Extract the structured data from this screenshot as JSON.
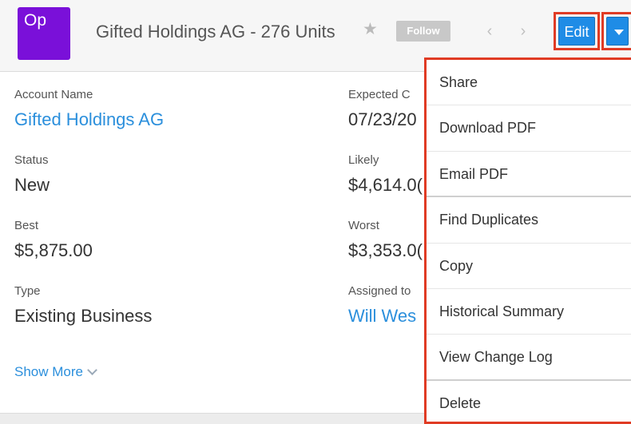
{
  "header": {
    "module_badge": "Op",
    "record_title": "Gifted Holdings AG - 276 Units",
    "follow_label": "Follow",
    "edit_label": "Edit",
    "badge_color": "#7a10d9",
    "accent_color": "#1f8ce6",
    "highlight_color": "#e03b24"
  },
  "fields_left": [
    {
      "label": "Account Name",
      "value": "Gifted Holdings AG"
    },
    {
      "label": "Status",
      "value": "New"
    },
    {
      "label": "Best",
      "value": "$5,875.00"
    },
    {
      "label": "Type",
      "value": "Existing Business"
    }
  ],
  "fields_right": [
    {
      "label": "Expected C",
      "value": "07/23/20"
    },
    {
      "label": "Likely",
      "value": "$4,614.0("
    },
    {
      "label": "Worst",
      "value": "$3,353.0("
    },
    {
      "label": "Assigned to",
      "value": "Will Wes"
    }
  ],
  "show_more_label": "Show More",
  "menu": {
    "items": [
      {
        "label": "Share"
      },
      {
        "label": "Download PDF"
      },
      {
        "label": "Email PDF"
      },
      {
        "label": "Find Duplicates"
      },
      {
        "label": "Copy"
      },
      {
        "label": "Historical Summary"
      },
      {
        "label": "View Change Log"
      },
      {
        "label": "Delete"
      }
    ]
  }
}
